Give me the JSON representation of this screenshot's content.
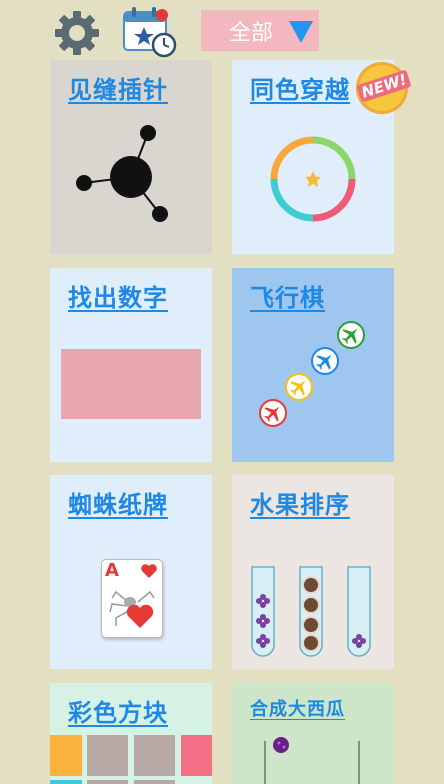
{
  "toolbar": {
    "settings_icon": "gear-icon",
    "calendar_icon": "calendar-clock-icon",
    "filter_label": "全部",
    "filter_arrow_icon": "triangle-down-icon"
  },
  "games": [
    {
      "title": "见缝插针",
      "bg": "#d9d6cf",
      "icon": "pin-ball-icon"
    },
    {
      "title": "同色穿越",
      "bg": "#e0edfb",
      "icon": "color-ring-icon",
      "badge": "NEW!"
    },
    {
      "title": "找出数字",
      "bg": "#e0edfb",
      "icon": "pink-rectangle-icon"
    },
    {
      "title": "飞行棋",
      "bg": "#9ec6ef",
      "icon": "airplane-pieces-icon"
    },
    {
      "title": "蜘蛛纸牌",
      "bg": "#e0edfb",
      "icon": "spider-card-icon",
      "card_rank": "A"
    },
    {
      "title": "水果排序",
      "bg": "#ebe6e2",
      "icon": "fruit-tubes-icon"
    },
    {
      "title": "彩色方块",
      "bg": "#d6f2e4",
      "icon": "color-blocks-icon"
    },
    {
      "title": "合成大西瓜",
      "bg": "#cde5c9",
      "icon": "watermelon-icon"
    }
  ],
  "colors": {
    "page_bg": "#e3dfc3",
    "title_blue": "#1e88e5",
    "filter_bg": "#f3b8bf"
  }
}
